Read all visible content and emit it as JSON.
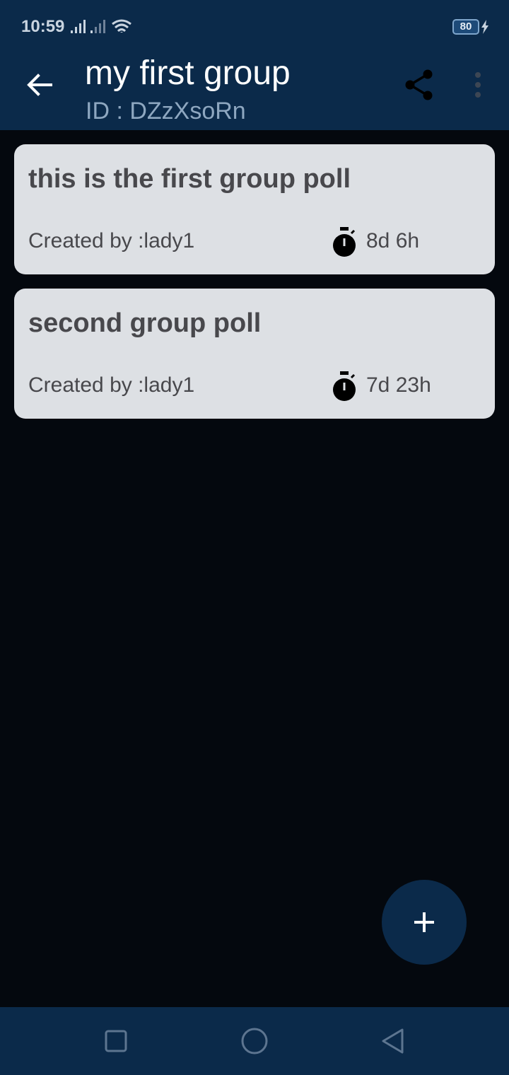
{
  "status_bar": {
    "time": "10:59",
    "battery_level": "80",
    "icons": [
      "signal-icon",
      "signal-icon",
      "wifi-icon",
      "battery-icon",
      "charging-icon"
    ]
  },
  "app_bar": {
    "title": "my first group",
    "subtitle": "ID : DZzXsoRn",
    "icons": [
      "back-arrow-icon",
      "share-icon",
      "more-vert-icon"
    ]
  },
  "polls": [
    {
      "title": "this is the first group poll",
      "author": "Created by :lady1",
      "time_left": "8d 6h"
    },
    {
      "title": "second group poll",
      "author": "Created by :lady1",
      "time_left": "7d 23h"
    }
  ],
  "fab": {
    "icon": "plus-icon"
  },
  "nav_bar": {
    "icons": [
      "recents-square-icon",
      "home-circle-icon",
      "back-triangle-icon"
    ]
  },
  "colors": {
    "primary": "#0b2a4a",
    "background": "#04080e",
    "card": "#dde0e4",
    "card_text": "#48484c",
    "subtitle": "#8ea7c0"
  }
}
